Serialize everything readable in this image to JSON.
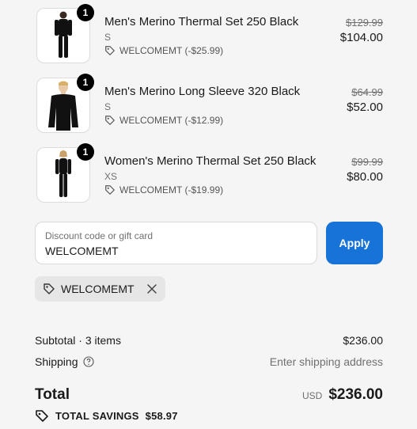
{
  "cart": {
    "items": [
      {
        "title": "Men's Merino Thermal Set 250 Black",
        "variant": "S",
        "quantity": "1",
        "discount": "WELCOMEMT (-$25.99)",
        "original_price": "$129.99",
        "price": "$104.00",
        "thumb": "man-thermal-set"
      },
      {
        "title": "Men's Merino Long Sleeve 320 Black",
        "variant": "S",
        "quantity": "1",
        "discount": "WELCOMEMT (-$12.99)",
        "original_price": "$64.99",
        "price": "$52.00",
        "thumb": "man-long-sleeve"
      },
      {
        "title": "Women's Merino Thermal Set 250 Black",
        "variant": "XS",
        "quantity": "1",
        "discount": "WELCOMEMT (-$19.99)",
        "original_price": "$99.99",
        "price": "$80.00",
        "thumb": "woman-thermal-set"
      }
    ]
  },
  "discount_field": {
    "label": "Discount code or gift card",
    "value": "WELCOMEMT",
    "apply_label": "Apply"
  },
  "applied_code": {
    "code": "WELCOMEMT"
  },
  "summary": {
    "subtotal_label": "Subtotal · 3 items",
    "subtotal_value": "$236.00",
    "shipping_label": "Shipping",
    "shipping_value": "Enter shipping address",
    "total_label": "Total",
    "currency": "USD",
    "total_value": "$236.00",
    "savings_label": "TOTAL SAVINGS",
    "savings_value": "$58.97"
  },
  "colors": {
    "accent": "#1773d8",
    "background": "#f5f5f5"
  },
  "icons": [
    "tag-icon",
    "close-icon",
    "help-circle-icon",
    "savings-tag-icon"
  ]
}
